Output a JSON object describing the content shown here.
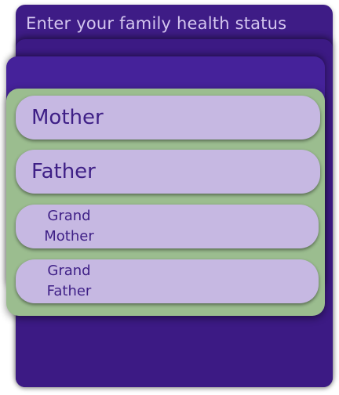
{
  "header": {
    "title": "Enter your family health status"
  },
  "members": [
    {
      "label": "Mother"
    },
    {
      "label": "Father"
    },
    {
      "label_line1": "Grand",
      "label_line2": "Mother"
    },
    {
      "label_line1": "Grand",
      "label_line2": "Father"
    }
  ],
  "colors": {
    "panel_purple": "#3e1c86",
    "card_green": "#9bbd8f",
    "button_lavender": "#c6b8e2",
    "text_purple": "#3e1f86",
    "title_text": "#d4c6ef"
  }
}
